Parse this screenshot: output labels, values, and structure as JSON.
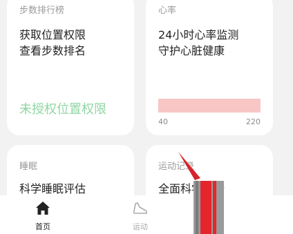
{
  "cards": {
    "steps": {
      "title": "步数排行榜",
      "line1": "获取位置权限",
      "line2": "查看步数排名",
      "status": "未授权位置权限",
      "status_color": "#8fd6a3"
    },
    "heart_rate": {
      "title": "心率",
      "line1": "24小时心率监测",
      "line2": "守护心脏健康",
      "scale_min": "40",
      "scale_max": "220",
      "bar_color": "#f9c6c6"
    },
    "sleep": {
      "title": "睡眠",
      "line1": "科学睡眠评估"
    },
    "exercise_record": {
      "title": "运动记录",
      "line1": "全面科学分析"
    }
  },
  "bottom_nav": {
    "items": [
      {
        "label": "首页",
        "icon": "home-icon",
        "active": true
      },
      {
        "label": "运动",
        "icon": "shoe-icon",
        "active": false
      }
    ],
    "active_color": "#222222",
    "inactive_color": "#aaaaaa"
  }
}
